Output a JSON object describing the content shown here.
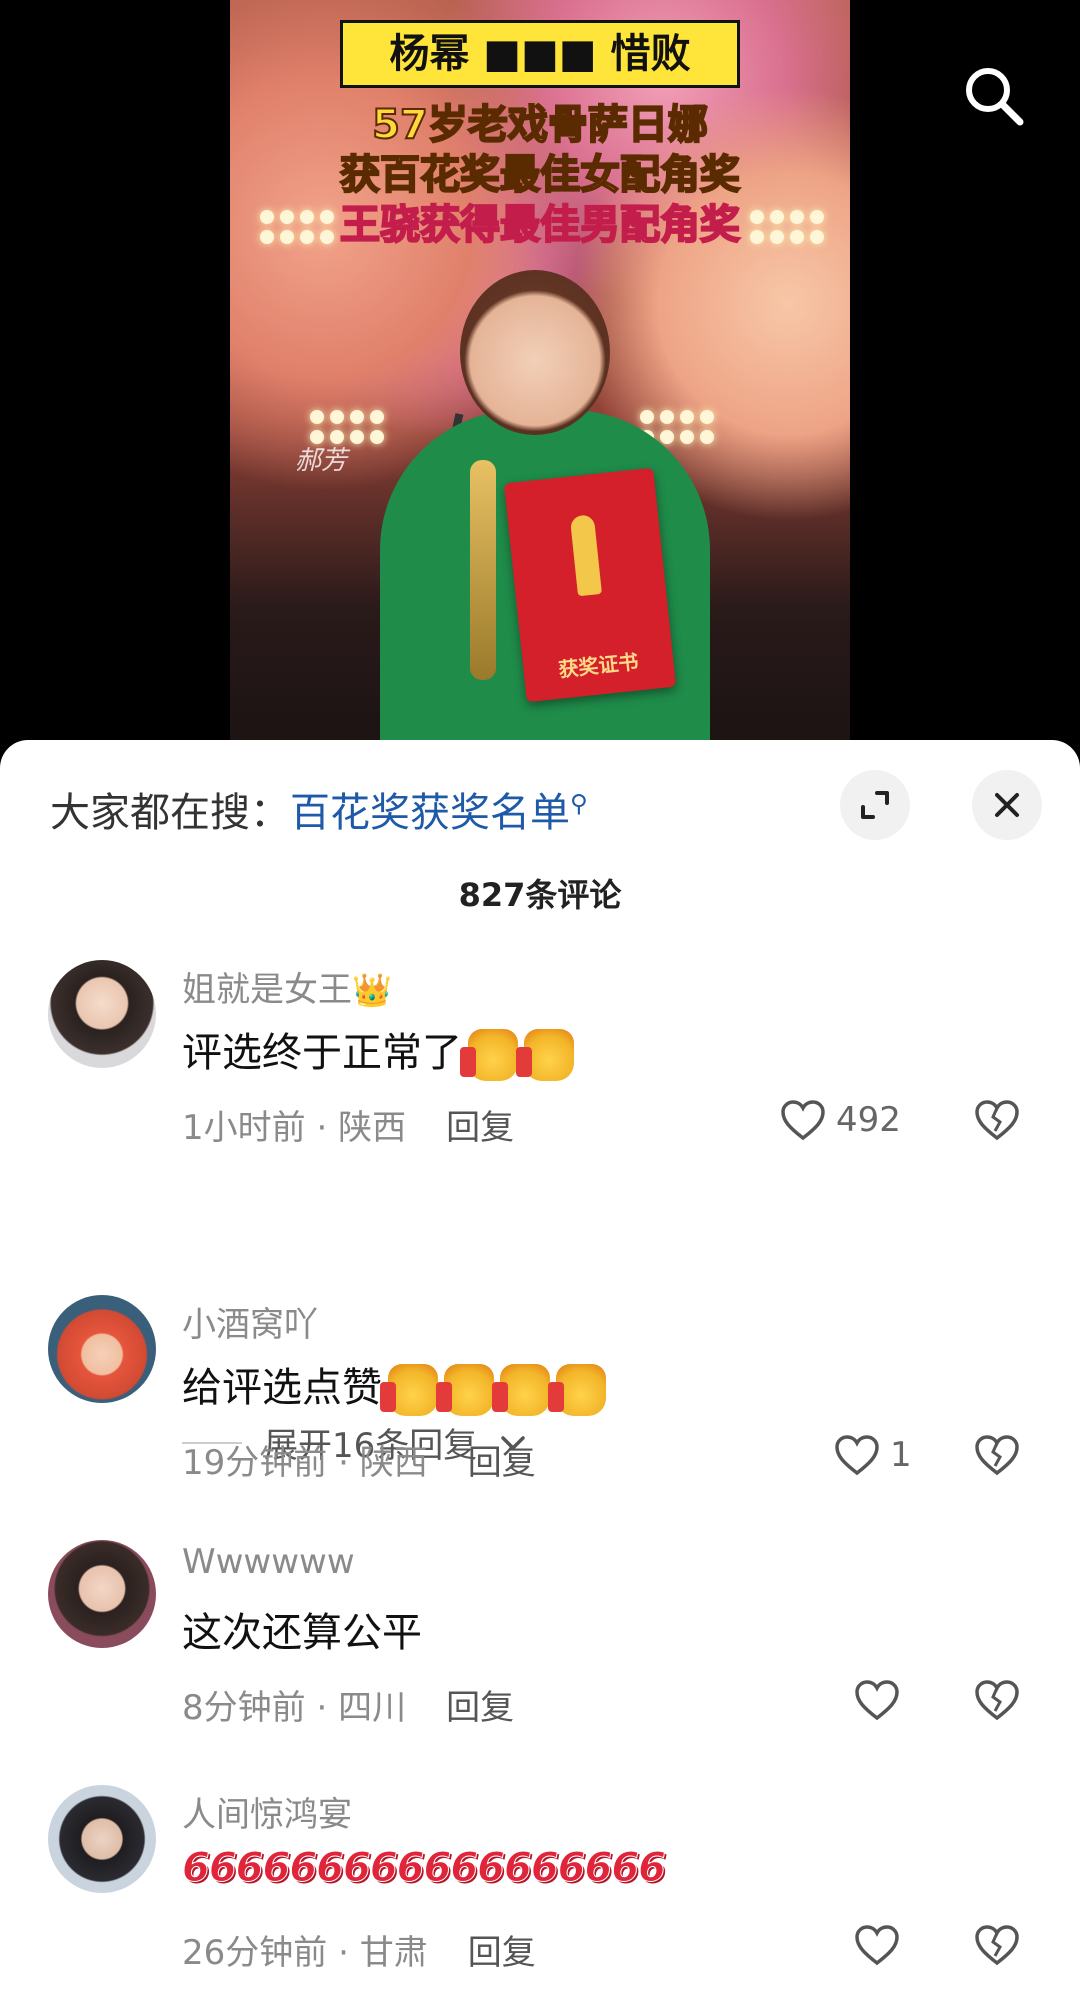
{
  "video": {
    "headline_top": "杨幂 ■■■ 惜败",
    "headline_line1": "57岁老戏骨萨日娜",
    "headline_line2": "获百花奖最佳女配角奖",
    "headline_line3": "王骁获得最佳男配角奖",
    "certificate_text": "获奖证书",
    "watermark": "郝芳",
    "search_icon": "search-icon"
  },
  "sheet": {
    "search_prefix": "大家都在搜：",
    "search_query": "百花奖获奖名单",
    "expand_icon": "expand-icon",
    "close_icon": "close-icon",
    "comment_count": "827条评论"
  },
  "comments": [
    {
      "username": "姐就是女王",
      "badge": "👑",
      "text": "评选终于正常了",
      "emoji_thumbs": 2,
      "time": "1小时前",
      "location": "陕西",
      "reply_label": "回复",
      "likes": "492",
      "expand_replies": "展开16条回复"
    },
    {
      "username": "小酒窝吖",
      "text": "给评选点赞",
      "emoji_thumbs": 4,
      "time": "19分钟前",
      "location": "陕西",
      "reply_label": "回复",
      "likes": "1"
    },
    {
      "username": "Wwwwww",
      "text": "这次还算公平",
      "time": "8分钟前",
      "location": "四川",
      "reply_label": "回复",
      "likes": ""
    },
    {
      "username": "人间惊鸿宴",
      "text": "666666666666666666",
      "time": "26分钟前",
      "location": "甘肃",
      "reply_label": "回复",
      "likes": ""
    }
  ],
  "colors": {
    "link_blue": "#1e5aa8",
    "muted_gray": "#8a8a8a"
  }
}
